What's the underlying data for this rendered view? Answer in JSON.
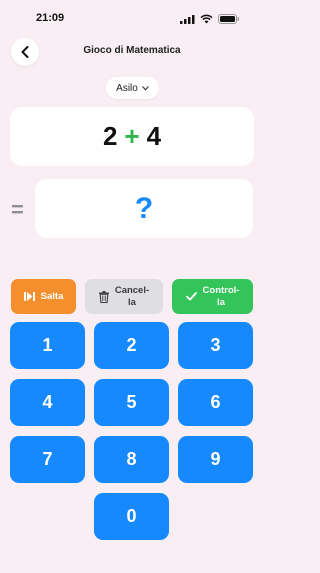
{
  "status": {
    "time": "21:09"
  },
  "header": {
    "title": "Gioco di Matematica"
  },
  "level": {
    "selected": "Asilo"
  },
  "problem": {
    "left": "2",
    "operator": "+",
    "right": "4"
  },
  "answer": {
    "equals": "=",
    "value": "?"
  },
  "actions": {
    "skip": "Salta",
    "delete_line1": "Cancel-",
    "delete_line2": "la",
    "check_line1": "Control-",
    "check_line2": "la"
  },
  "keypad": [
    "1",
    "2",
    "3",
    "4",
    "5",
    "6",
    "7",
    "8",
    "9",
    "0"
  ],
  "colors": {
    "background": "#f8eef3",
    "key": "#1689ff",
    "skip": "#f58f2d",
    "delete": "#dedee3",
    "check": "#34c55a",
    "operator": "#2fb64c",
    "question": "#1689ff"
  }
}
